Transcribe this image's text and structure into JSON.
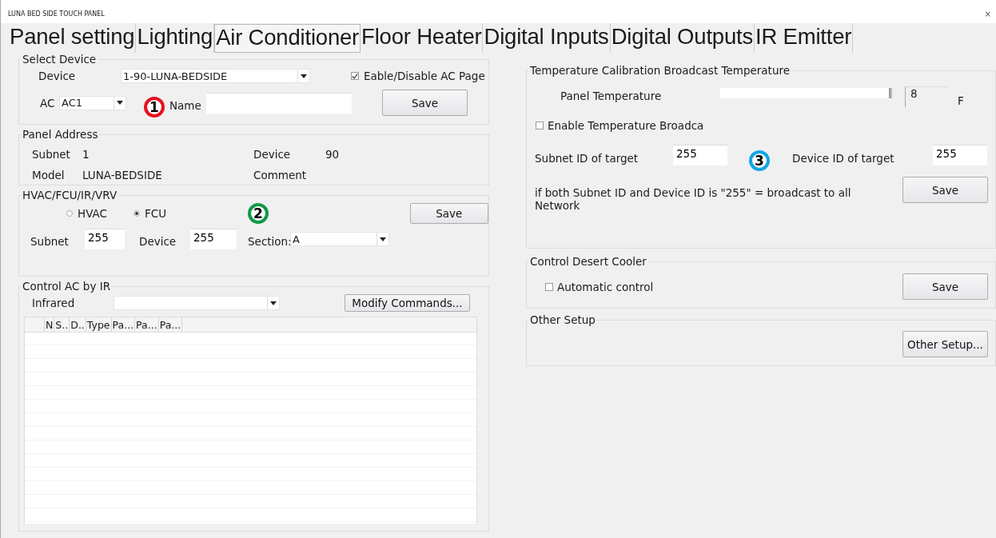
{
  "window": {
    "title": "LUNA BED SIDE TOUCH PANEL",
    "close": "×"
  },
  "tabs": [
    {
      "label": "Panel setting",
      "selected": false
    },
    {
      "label": "Lighting",
      "selected": false
    },
    {
      "label": "Air Conditioner",
      "selected": true
    },
    {
      "label": "Floor Heater",
      "selected": false
    },
    {
      "label": "Digital Inputs",
      "selected": false
    },
    {
      "label": "Digital Outputs",
      "selected": false
    },
    {
      "label": "IR Emitter",
      "selected": false
    }
  ],
  "select_device": {
    "title": "Select Device",
    "device_label": "Device",
    "device_value": "1-90-LUNA-BEDSIDE",
    "enable_label": "Eable/Disable AC Page",
    "enable_checked": true,
    "ac_label": "AC",
    "ac_value": "AC1",
    "name_label": "Name",
    "save": "Save"
  },
  "panel_address": {
    "title": "Panel Address",
    "subnet_label": "Subnet",
    "subnet": "1",
    "device_label": "Device",
    "device": "90",
    "model_label": "Model",
    "model": "LUNA-BEDSIDE",
    "comment_label": "Comment"
  },
  "hvac": {
    "title": "HVAC/FCU/IR/VRV",
    "options": [
      {
        "label": "HVAC",
        "selected": false
      },
      {
        "label": "FCU",
        "selected": true
      }
    ],
    "save": "Save",
    "subnet_label": "Subnet",
    "subnet": "255",
    "device_label": "Device",
    "device": "255",
    "section_label": "Section:",
    "section": "A"
  },
  "ir": {
    "title": "Control AC by IR",
    "infrared_label": "Infrared",
    "modify": "Modify Commands...",
    "columns": [
      "N",
      "S..",
      "D..",
      "Type",
      "Pa...",
      "Pa...",
      "Pa..."
    ]
  },
  "temperature": {
    "title": "Temperature Calibration  Broadcast Temperature",
    "panel_label": "Panel Temperature",
    "level": 1,
    "value": "8",
    "unit": "F",
    "broadcast_label": "Enable Temperature Broadca",
    "broadcast_checked": false,
    "subnet_label": "Subnet ID of target",
    "subnet": "255",
    "device_label": "Device ID of target",
    "device": "255",
    "note": "if both Subnet ID and Device ID is \"255\" = broadcast to all Network",
    "save": "Save"
  },
  "desert_cooler": {
    "title": "Control Desert Cooler",
    "auto_label": "Automatic control",
    "auto_checked": false,
    "save": "Save"
  },
  "other": {
    "title": "Other Setup",
    "button": "Other Setup..."
  },
  "markers": [
    {
      "label": "1",
      "color": "#e8101e"
    },
    {
      "label": "2",
      "color": "#0f9a47"
    },
    {
      "label": "3",
      "color": "#10a6e4"
    }
  ]
}
